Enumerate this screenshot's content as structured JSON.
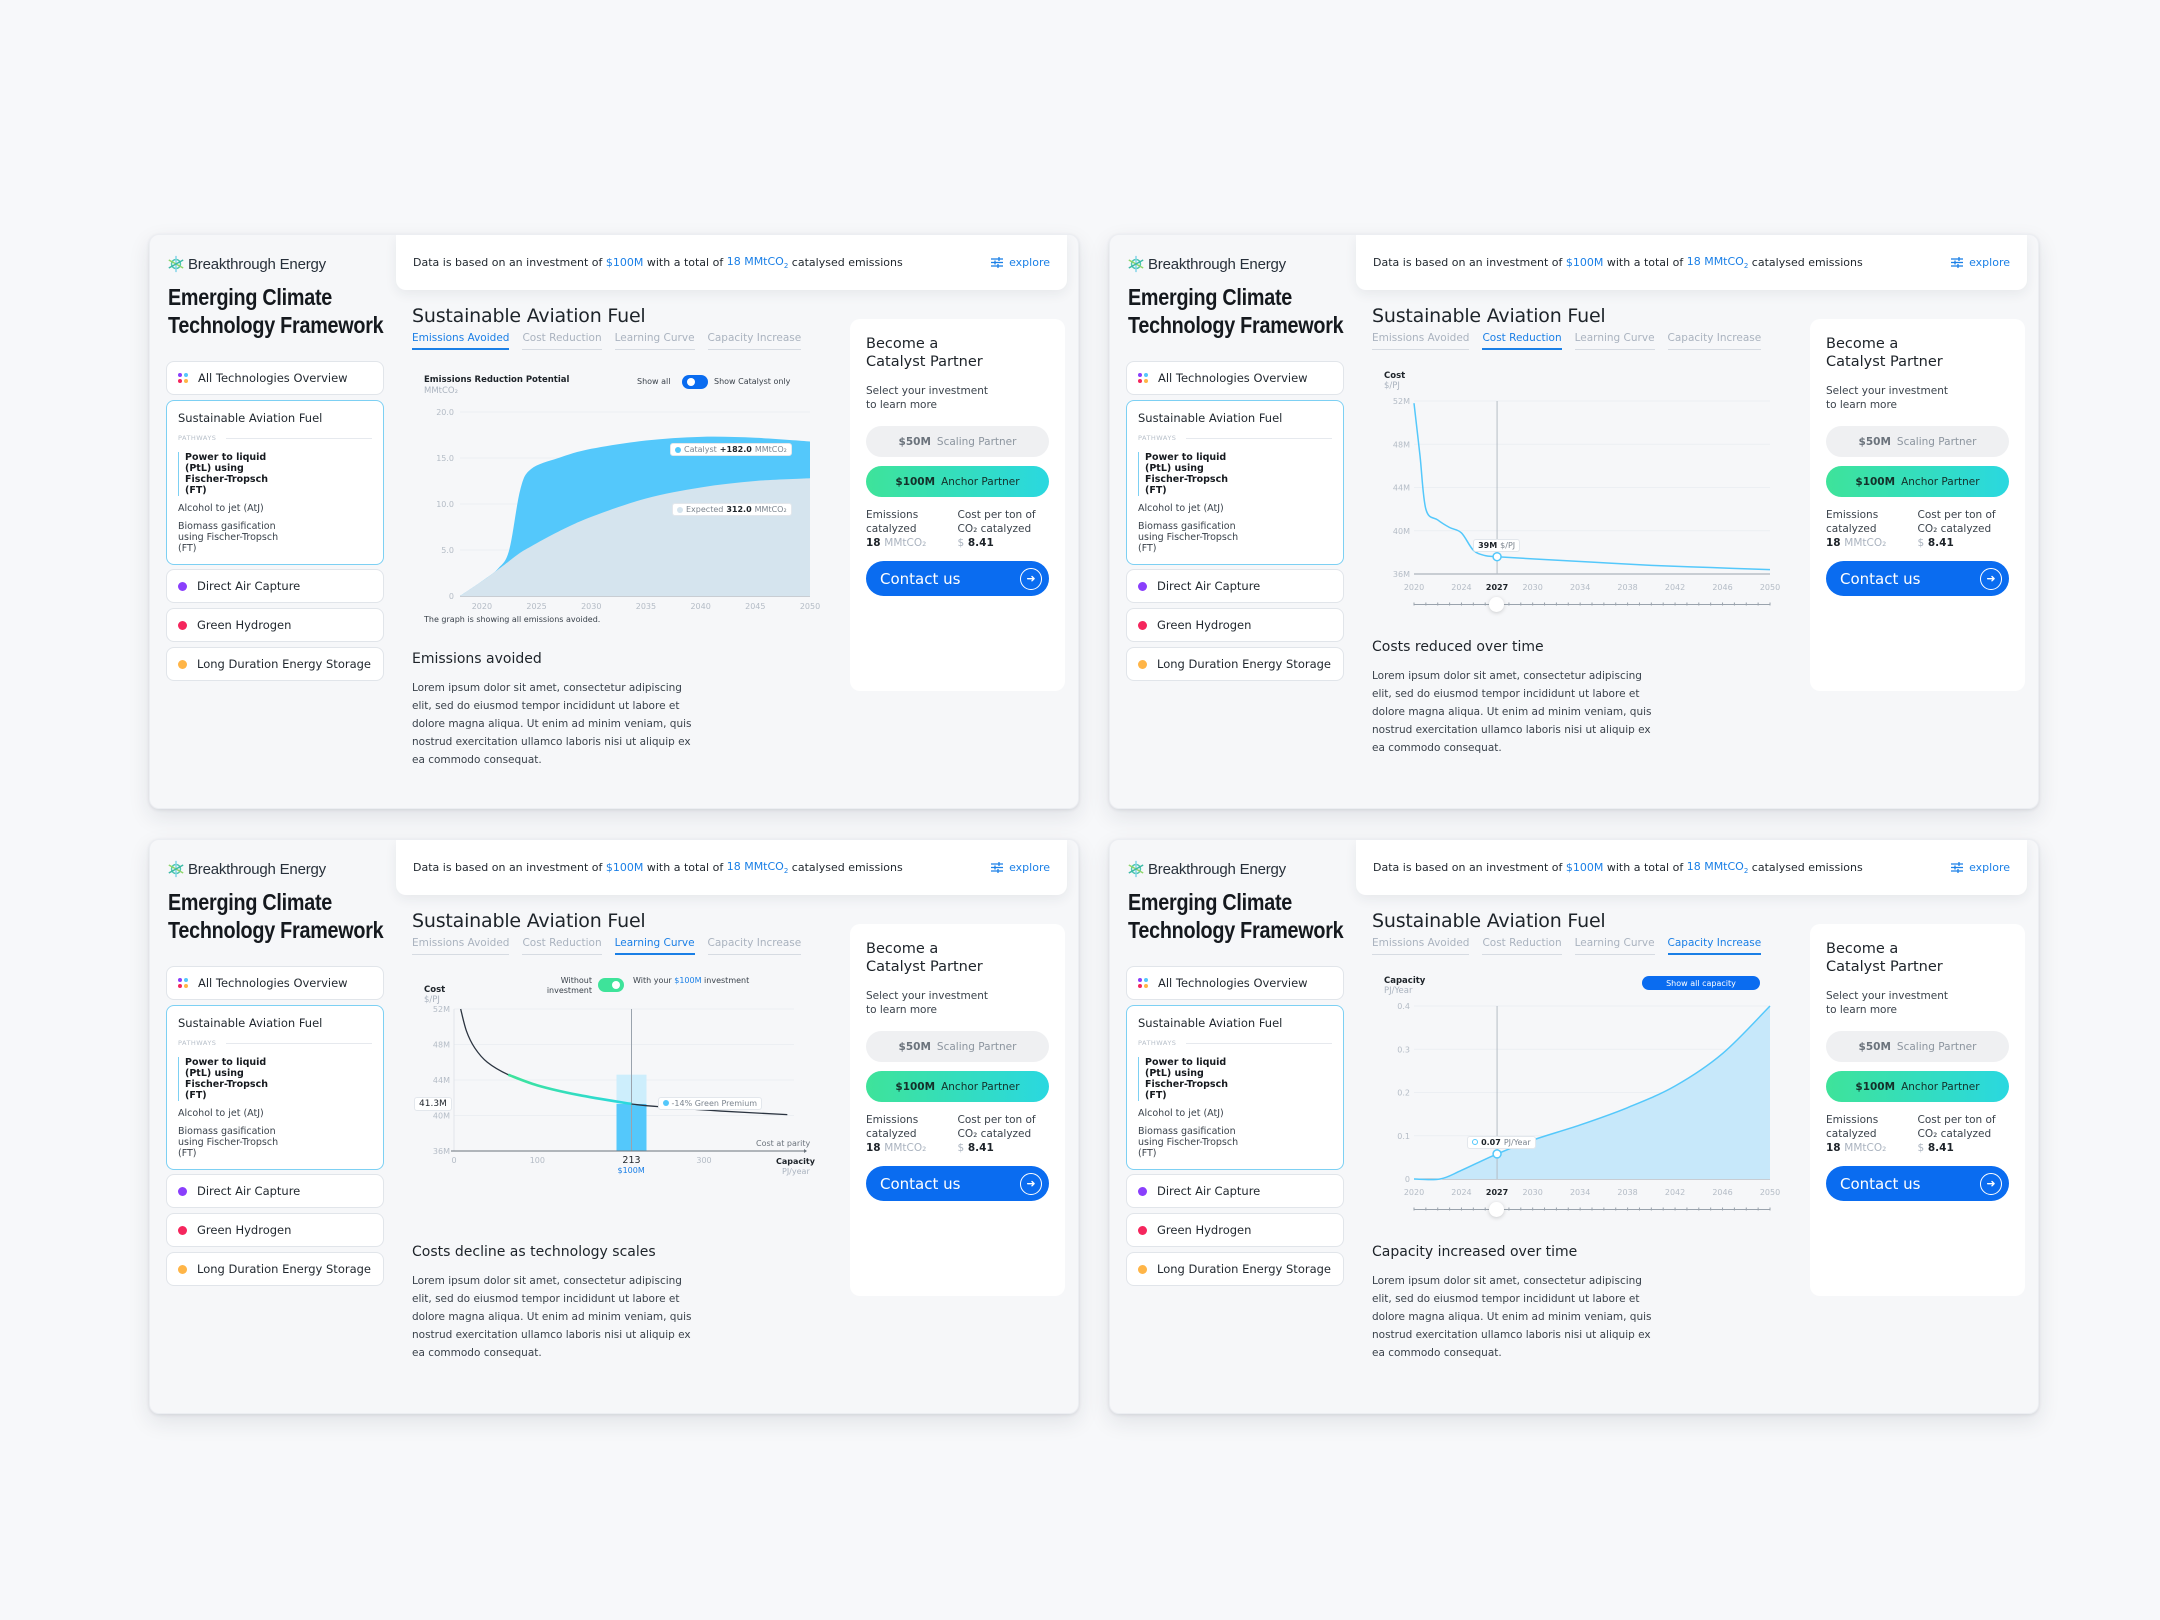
{
  "brand": {
    "name": "Breakthrough Energy",
    "app_title": "Emerging Climate Technology Framework"
  },
  "infobar": {
    "prefix": "Data is based on an investment of ",
    "investment": "$100M",
    "middle": " with a total of ",
    "emissions": "18 MMtCO",
    "emissions_sub": "2",
    "suffix": " catalysed emissions",
    "explore_label": "explore",
    "explore_icon": "sliders-icon"
  },
  "sidebar": {
    "overview_label": "All Technologies Overview",
    "active_tech": {
      "label": "Sustainable Aviation Fuel",
      "color": "#54c8fb",
      "pathways_label": "PATHWAYS",
      "pathways": [
        "Power to liquid (PtL) using Fischer-Tropsch (FT)",
        "Alcohol to jet (AtJ)",
        "Biomass gasification using Fischer-Tropsch (FT)"
      ]
    },
    "items": [
      {
        "label": "Direct Air Capture",
        "color": "#8a3ffc"
      },
      {
        "label": "Green Hydrogen",
        "color": "#f5265d"
      },
      {
        "label": "Long Duration Energy Storage",
        "color": "#ffb547"
      }
    ]
  },
  "main": {
    "title": "Sustainable Aviation Fuel",
    "tabs": [
      "Emissions Avoided",
      "Cost Reduction",
      "Learning Curve",
      "Capacity Increase"
    ]
  },
  "cta": {
    "title": "Become a\nCatalyst Partner",
    "subtitle": "Select your investment\nto learn more",
    "options": [
      {
        "amount": "$50M",
        "label": "Scaling Partner",
        "selected": false
      },
      {
        "amount": "$100M",
        "label": "Anchor Partner",
        "selected": true
      }
    ],
    "stat1_label": "Emissions catalyzed",
    "stat1_value": "18",
    "stat1_unit": "MMtCO₂",
    "stat2_label": "Cost per ton of CO₂ catalyzed",
    "stat2_currency": "$",
    "stat2_value": "8.41",
    "contact_label": "Contact us"
  },
  "body_text": "Lorem ipsum dolor sit amet, consectetur adipiscing elit, sed do eiusmod tempor incididunt ut labore et dolore magna aliqua. Ut enim ad minim veniam, quis nostrud exercitation ullamco laboris nisi ut aliquip ex ea commodo consequat.",
  "panels": [
    {
      "active_tab": 0,
      "section_heading": "Emissions avoided",
      "toggle": {
        "left": "Show all",
        "right": "Show Catalyst only"
      },
      "footnote": "The graph is showing all emissions avoided.",
      "chips": [
        {
          "label": "Catalyst",
          "value": "+182.0",
          "unit": "MMtCO₂",
          "color": "#54c8fb"
        },
        {
          "label": "Expected",
          "value": "312.0",
          "unit": "MMtCO₂",
          "color": "#d5e4ee"
        }
      ]
    },
    {
      "active_tab": 1,
      "section_heading": "Costs reduced over time",
      "selected_year": "2027",
      "tooltip": {
        "value": "39M",
        "unit": "$/PJ"
      },
      "slider_value_fraction": 0.233
    },
    {
      "active_tab": 2,
      "section_heading": "Costs decline as technology scales",
      "toggle": {
        "left": "Without investment",
        "right_prefix": "With your ",
        "right_amount": "$100M",
        "right_suffix": " investment"
      },
      "y_marker": "41.3M",
      "premium_chip": "-14% Green Premium",
      "parity_label": "Cost at parity",
      "x_marker": "213",
      "x_marker_amount": "$100M"
    },
    {
      "active_tab": 3,
      "section_heading": "Capacity increased over time",
      "show_all_label": "Show all capacity",
      "selected_year": "2027",
      "tooltip": {
        "value": "0.07",
        "unit": "PJ/Year"
      },
      "slider_value_fraction": 0.233
    }
  ],
  "chart_data": [
    {
      "type": "area",
      "title": "Emissions Reduction Potential",
      "ylabel": "MMtCO₂",
      "ylim": [
        0,
        20
      ],
      "yticks": [
        "0",
        "5.0",
        "10.0",
        "15.0",
        "20.0"
      ],
      "xticks": [
        "2020",
        "2025",
        "2030",
        "2035",
        "2040",
        "2045",
        "2050"
      ],
      "x": [
        2018,
        2020,
        2021.5,
        2022.5,
        2023.5,
        2024.5,
        2027,
        2030,
        2035,
        2040,
        2045,
        2050
      ],
      "series": [
        {
          "name": "Expected",
          "color": "#d5e4ee",
          "values": [
            0,
            1.6,
            2.9,
            3.8,
            4.7,
            5.4,
            7.0,
            8.6,
            10.6,
            11.8,
            12.5,
            12.8
          ]
        },
        {
          "name": "Catalyst",
          "color": "#54c8fb",
          "values": [
            0,
            1.6,
            3.0,
            5.0,
            11.5,
            13.8,
            15.0,
            16.0,
            16.9,
            17.3,
            17.2,
            16.8
          ]
        }
      ]
    },
    {
      "type": "line",
      "title": "Cost",
      "ylabel": "$/PJ",
      "ylim": [
        36,
        52
      ],
      "yticks": [
        "36M",
        "40M",
        "44M",
        "48M",
        "52M"
      ],
      "xticks": [
        "2020",
        "2024",
        "2027",
        "2030",
        "2034",
        "2038",
        "2042",
        "2046",
        "2050"
      ],
      "x": [
        2020,
        2020.5,
        2021,
        2022,
        2023,
        2024,
        2025,
        2026,
        2027,
        2030,
        2035,
        2040,
        2045,
        2050
      ],
      "series": [
        {
          "name": "Cost",
          "color": "#54c8fb",
          "values": [
            51.8,
            47.0,
            42.0,
            41.0,
            40.3,
            39.8,
            38.2,
            37.7,
            37.6,
            37.4,
            37.1,
            36.8,
            36.6,
            36.4
          ]
        }
      ]
    },
    {
      "type": "line",
      "title": "Cost",
      "ylabel": "$/PJ",
      "xlabel": "Capacity",
      "xunit": "PJ/year",
      "ylim": [
        36,
        52
      ],
      "xlim": [
        0,
        420
      ],
      "yticks": [
        "36M",
        "40M",
        "44M",
        "48M",
        "52M"
      ],
      "xticks": [
        "0",
        "100",
        "213",
        "300"
      ],
      "x": [
        8,
        15,
        25,
        40,
        65,
        100,
        150,
        213,
        260,
        320,
        400
      ],
      "series": [
        {
          "name": "Without investment",
          "color": "#2b3440",
          "values": [
            52,
            49.5,
            47.6,
            46.0,
            44.6,
            43.4,
            42.3,
            41.3,
            40.9,
            40.5,
            40.1
          ]
        },
        {
          "name": "With investment",
          "color": "#3ee39a",
          "x_range": [
            65,
            213
          ]
        }
      ],
      "bar": {
        "x": 213,
        "base": 36,
        "value": 41.3,
        "ghost_top": 44.6
      }
    },
    {
      "type": "area",
      "title": "Capacity",
      "ylabel": "PJ/Year",
      "ylim": [
        0,
        0.4
      ],
      "yticks": [
        "0",
        "0.1",
        "0.2",
        "0.3",
        "0.4"
      ],
      "xticks": [
        "2020",
        "2024",
        "2027",
        "2030",
        "2034",
        "2038",
        "2042",
        "2046",
        "2050"
      ],
      "x": [
        2020,
        2022.2,
        2024,
        2027,
        2030,
        2034,
        2038,
        2042,
        2046,
        2050
      ],
      "series": [
        {
          "name": "Capacity",
          "color": "#54c8fb",
          "values": [
            0,
            0,
            0.02,
            0.058,
            0.09,
            0.125,
            0.165,
            0.215,
            0.29,
            0.4
          ]
        }
      ]
    }
  ]
}
